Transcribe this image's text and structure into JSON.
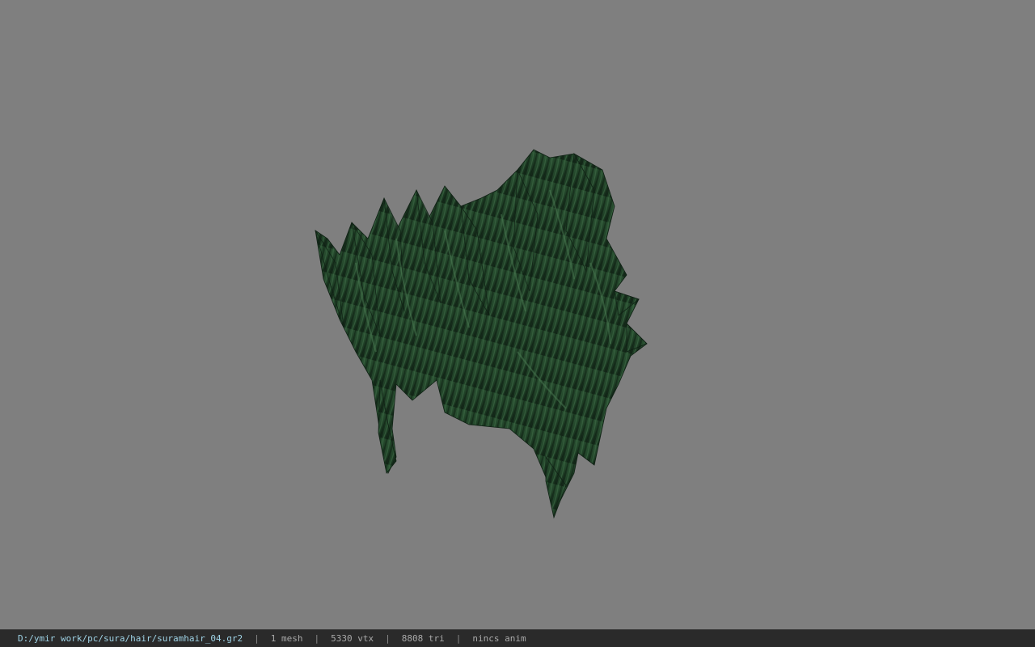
{
  "viewport": {
    "background_color": "#7f7f7f",
    "model": {
      "icon": "hair-mesh-icon",
      "primary_color": "#1f3f26",
      "highlight_color": "#3c6a45",
      "shadow_color": "#0f2014"
    }
  },
  "status_bar": {
    "file_path": "D:/ymir work/pc/sura/hair/suramhair_04.gr2",
    "separator": "|",
    "mesh_count": "1 mesh",
    "vertex_count": "5330 vtx",
    "triangle_count": "8808 tri",
    "animation": "nincs anim",
    "background_color": "#2a2a2a",
    "path_color": "#9fd3e6"
  }
}
